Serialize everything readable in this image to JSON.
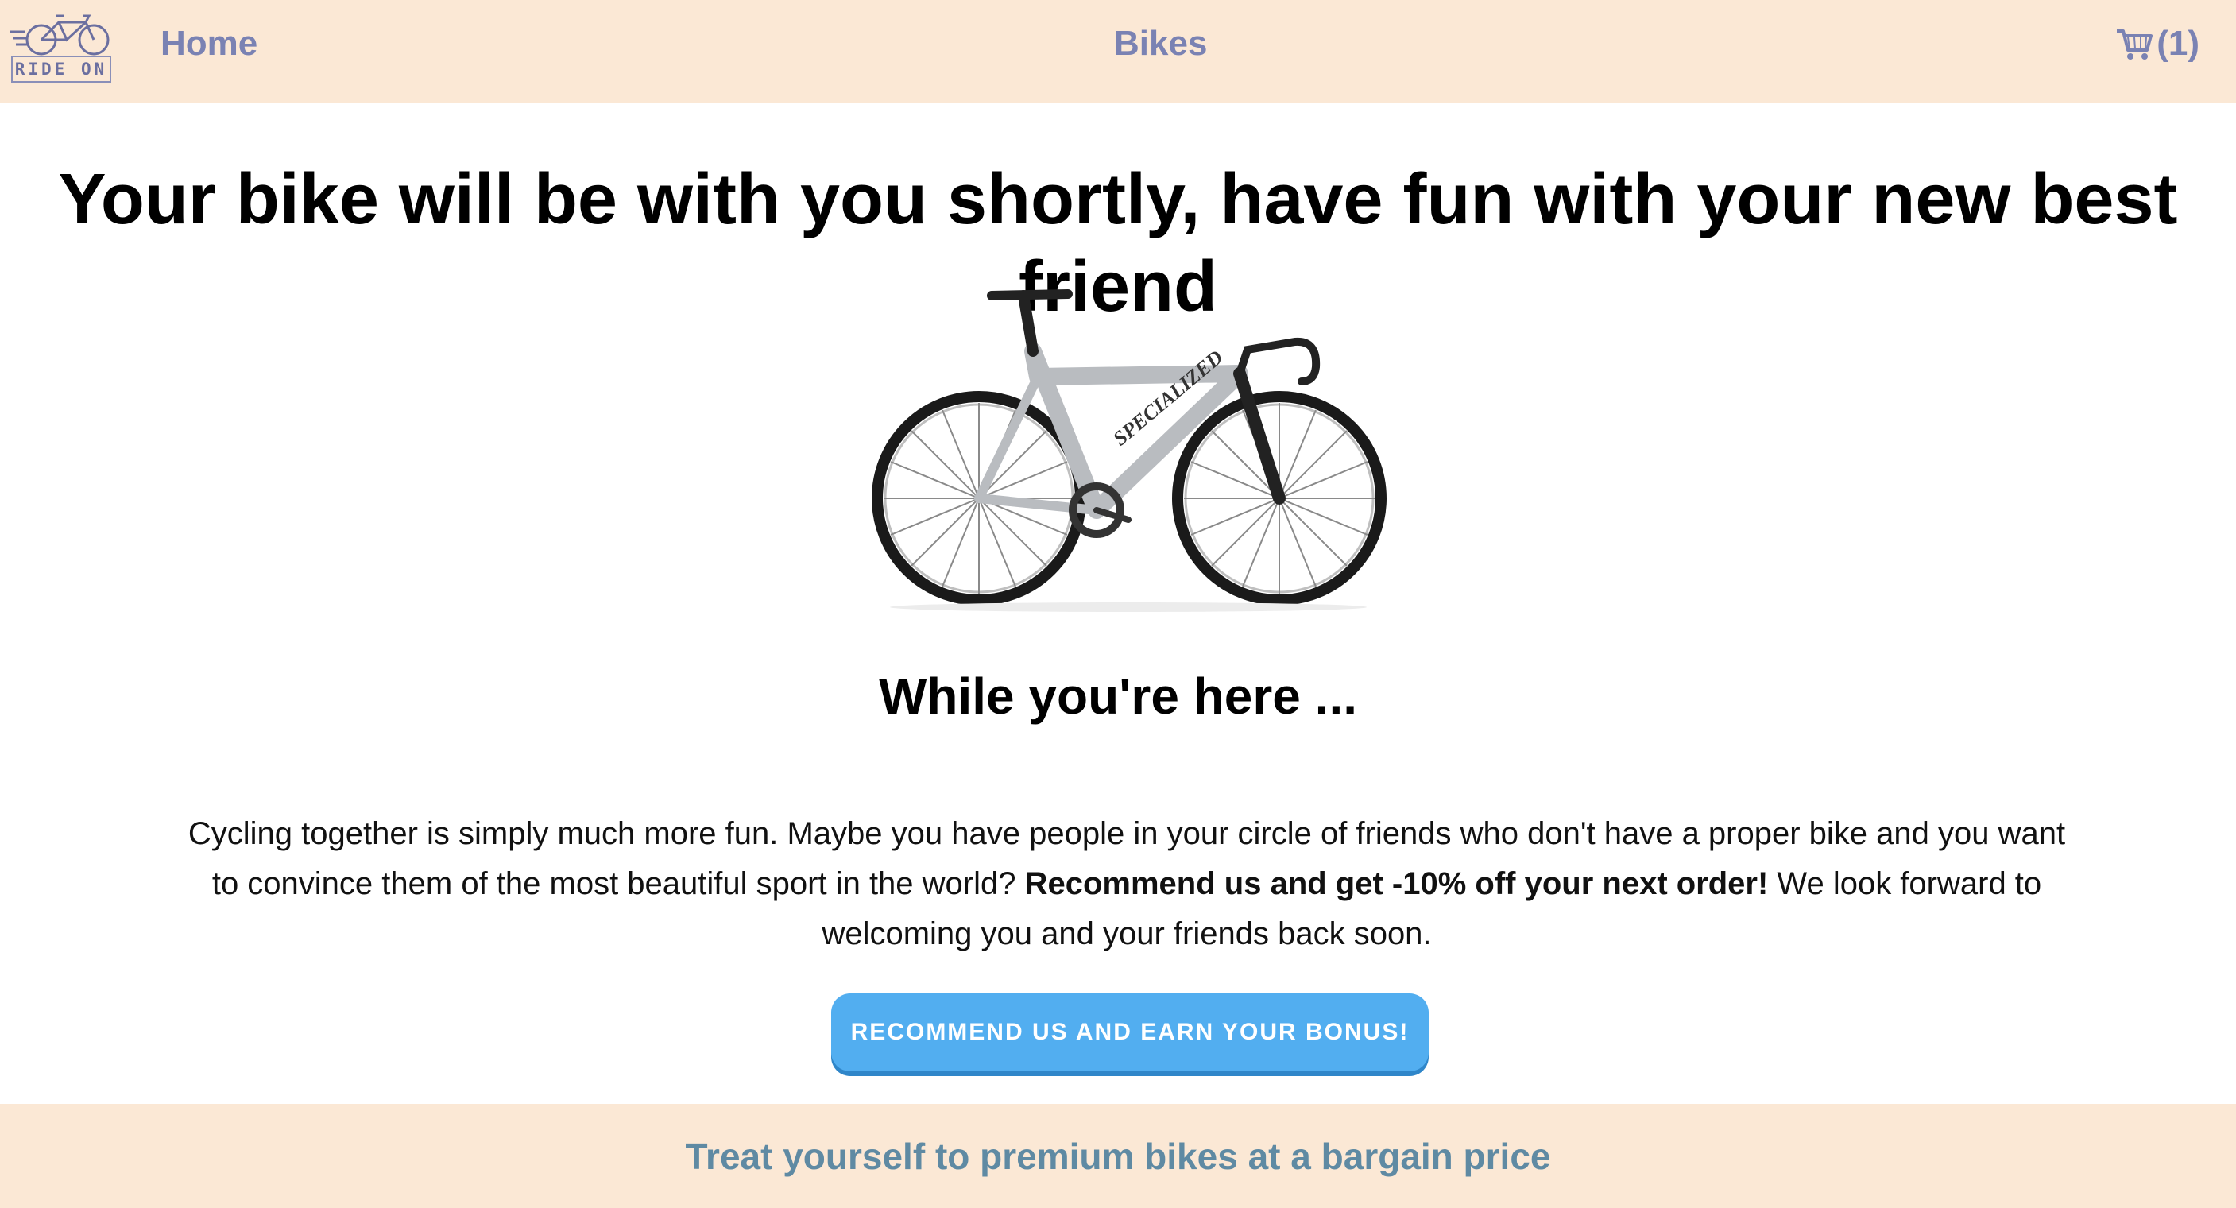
{
  "header": {
    "logo_text": "RIDE ON",
    "nav_home": "Home",
    "nav_bikes": "Bikes",
    "cart_icon": "shopping-cart-icon",
    "cart_count": "(1)"
  },
  "main": {
    "headline": "Your bike will be with you shortly, have fun with your new best friend",
    "bike_image": "road-bike-image",
    "bike_brand_on_frame": "SPECIALIZED",
    "subheading": "While you're here ...",
    "paragraph_part1": "Cycling together is simply much more fun. Maybe you have people in your circle of friends who don't have a proper bike and you want to convince them of the most beautiful sport in the world? ",
    "paragraph_bold": "Recommend us and get -10% off your next order!",
    "paragraph_part2": " We look forward to welcoming you and your friends back soon.",
    "cta_label": "RECOMMEND US AND EARN YOUR BONUS!"
  },
  "footer": {
    "text": "Treat yourself to premium bikes at a bargain price"
  },
  "colors": {
    "header_bg": "#fbe8d5",
    "nav_text": "#7a82b3",
    "cta_bg": "#52aef0",
    "footer_text": "#5f8aa3"
  }
}
